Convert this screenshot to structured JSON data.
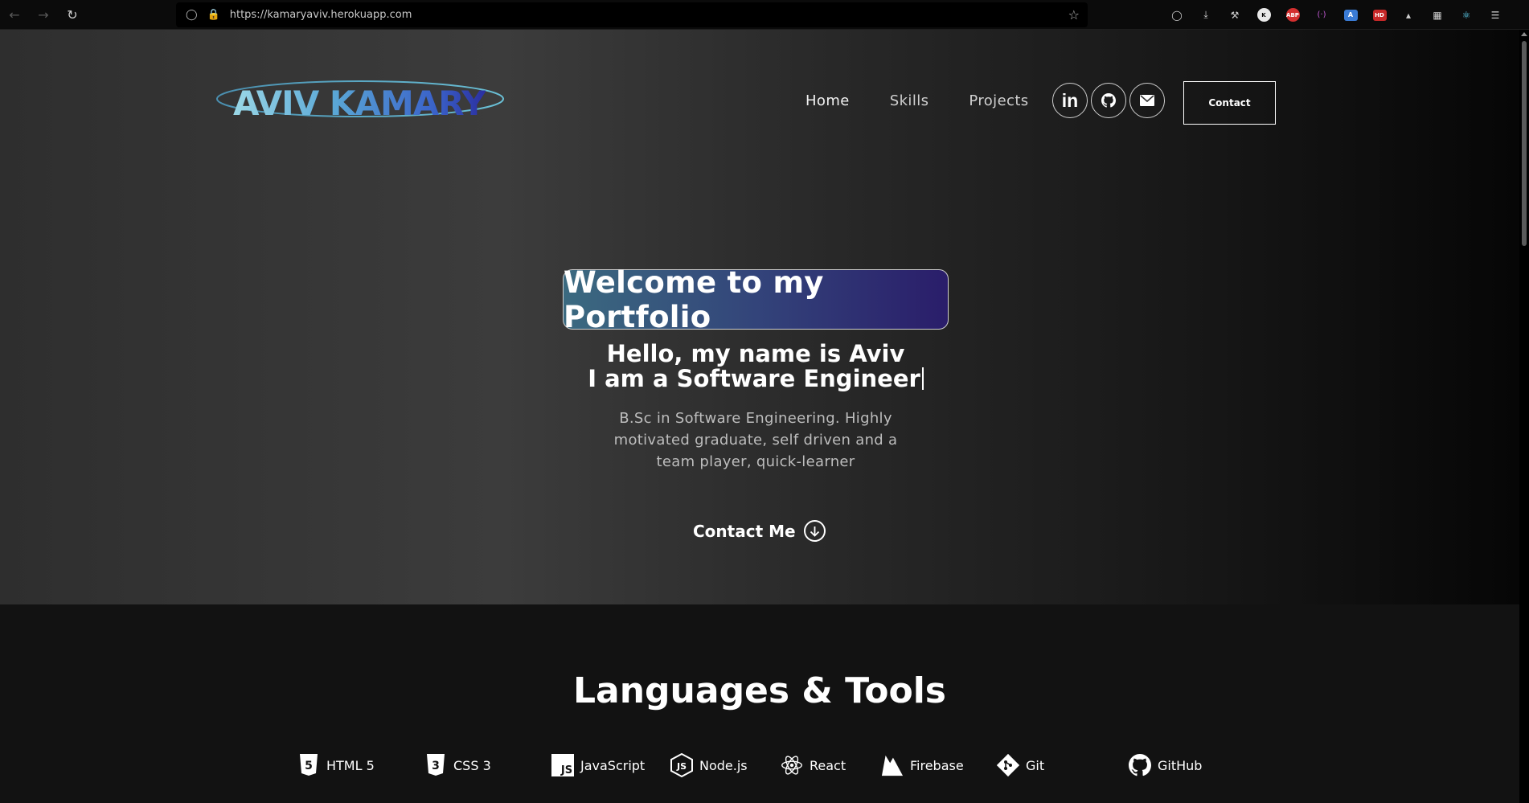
{
  "browser": {
    "url": "https://kamaryaviv.herokuapp.com",
    "extensions": [
      "pocket-icon",
      "download-icon",
      "wrench-icon",
      "k-icon",
      "abp-icon",
      "bracket-icon",
      "translate-icon",
      "hd-icon",
      "sneaker-icon",
      "qr-icon",
      "react-devtools-icon",
      "menu-icon"
    ],
    "ext_k": "K",
    "ext_abp": "ABP",
    "ext_hd": "HD",
    "ext_bracket": "(·)"
  },
  "header": {
    "logo": "AVIV KAMARY",
    "nav": [
      "Home",
      "Skills",
      "Projects"
    ],
    "contact_button": "Contact"
  },
  "hero": {
    "welcome": "Welcome to my Portfolio",
    "line1": "Hello, my name is Aviv",
    "line2": "I am a Software Engineer",
    "description": "B.Sc in Software Engineering. Highly motivated graduate, self driven and a team player, quick-learner",
    "cta": "Contact Me"
  },
  "skills": {
    "title": "Languages & Tools",
    "tools": [
      "HTML 5",
      "CSS 3",
      "JavaScript",
      "Node.js",
      "React",
      "Firebase",
      "Git",
      "GitHub"
    ]
  }
}
